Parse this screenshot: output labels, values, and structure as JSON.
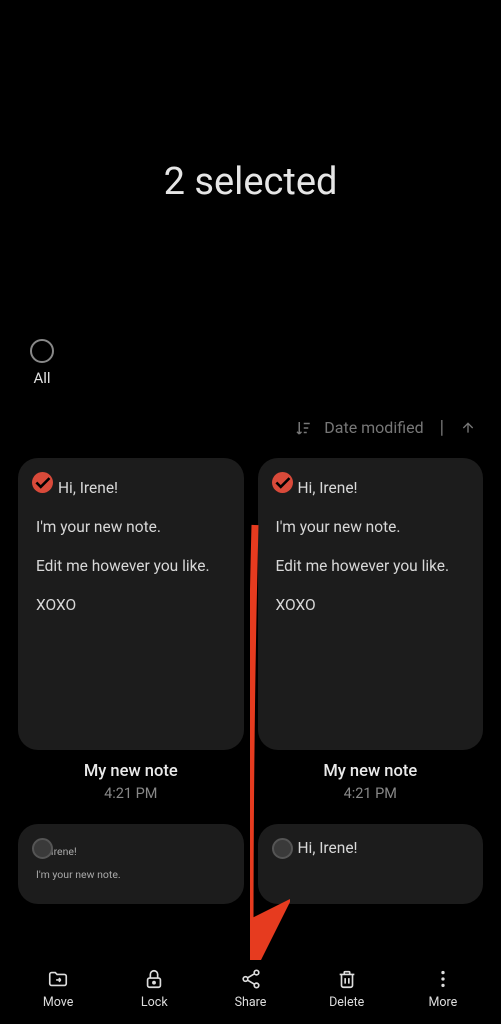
{
  "header": {
    "title": "2 selected"
  },
  "selectAll": {
    "label": "All"
  },
  "sort": {
    "label": "Date modified"
  },
  "notes": [
    {
      "greeting": "Hi, Irene!",
      "line1": "I'm your new note.",
      "line2": "Edit me however you like.",
      "line3": "XOXO",
      "title": "My new note",
      "time": "4:21 PM",
      "selected": true
    },
    {
      "greeting": "Hi, Irene!",
      "line1": "I'm your new note.",
      "line2": "Edit me however you like.",
      "line3": "XOXO",
      "title": "My new note",
      "time": "4:21 PM",
      "selected": true
    }
  ],
  "notesLower": [
    {
      "greeting": "Hi, Irene!",
      "line1": "I'm your new note.",
      "selected": false
    },
    {
      "greeting": "Hi, Irene!",
      "selected": false
    }
  ],
  "nav": {
    "move": "Move",
    "lock": "Lock",
    "share": "Share",
    "delete": "Delete",
    "more": "More"
  }
}
